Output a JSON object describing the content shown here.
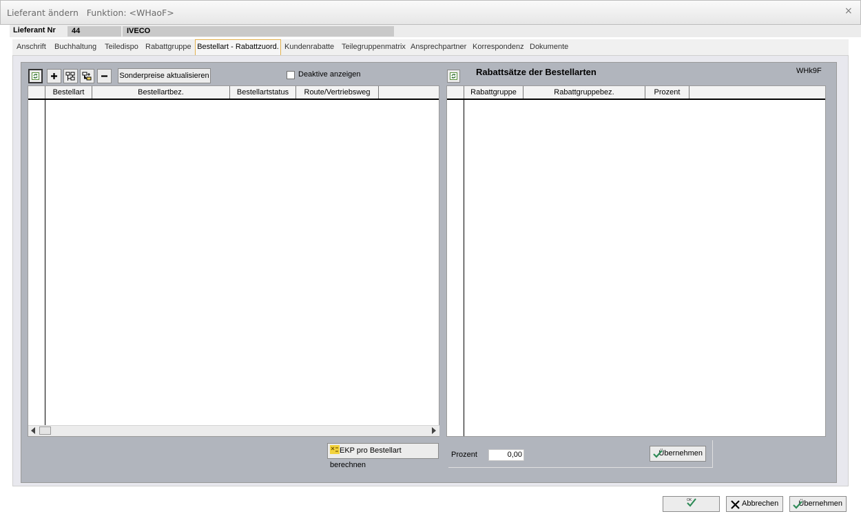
{
  "window": {
    "title": "Lieferant ändern   Funktion: <WHaoF>",
    "close_glyph": "×"
  },
  "header": {
    "lieferant_label": "Lieferant Nr",
    "lieferant_nr": "44",
    "lieferant_name": "IVECO"
  },
  "tabs": [
    {
      "label": "Anschrift"
    },
    {
      "label": "Buchhaltung"
    },
    {
      "label": "Teiledispo"
    },
    {
      "label": "Rabattgruppe"
    },
    {
      "label": "Bestellart - Rabattzuord."
    },
    {
      "label": "Kundenrabatte"
    },
    {
      "label": "Teilegruppenmatrix"
    },
    {
      "label": "Ansprechpartner"
    },
    {
      "label": "Korrespondenz"
    },
    {
      "label": "Dokumente"
    }
  ],
  "left_toolbar": {
    "icons": [
      "refresh-icon",
      "plus-icon",
      "tree-edit-icon",
      "tree-add-icon",
      "minus-icon"
    ],
    "sonderpreise_label": "Sonderpreise aktualisieren",
    "deaktive_label": "Deaktive anzeigen"
  },
  "left_grid": {
    "columns": [
      "Bestellart",
      "Bestellartbez.",
      "Bestellartstatus",
      "Route/Vertriebsweg"
    ]
  },
  "right_panel": {
    "title": "Rabattsätze der Bestellarten",
    "code": "WHk9F",
    "columns": [
      "Rabattgruppe",
      "Rabattgruppebez.",
      "Prozent"
    ],
    "prozent_label": "Prozent",
    "prozent_value": "0,00",
    "uebernehmen_label": "Übernehmen"
  },
  "ekp_label": "EKP pro Bestellart berechnen",
  "bottom": {
    "ok_label": "OK",
    "abbrechen_label": "Abbrechen",
    "uebernehmen_label": "Übernehmen"
  },
  "colors": {
    "panel_bg": "#b1b5bd",
    "active_tab_border": "#e2b04b",
    "check_green": "#2e8b57"
  }
}
